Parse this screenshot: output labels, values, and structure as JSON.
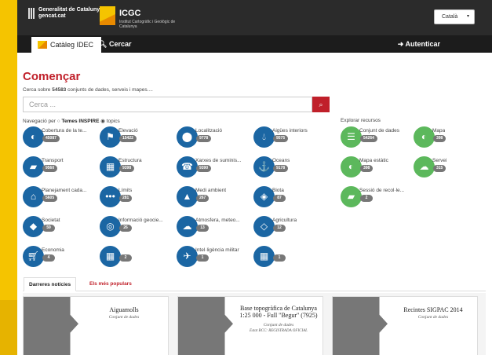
{
  "header": {
    "gencat_line1": "Generalitat de Catalunya",
    "gencat_line2": "gencat.cat",
    "icgc_name": "ICGC",
    "icgc_sub": "Institut Cartogràfic i Geològic de Catalunya",
    "language": "Català"
  },
  "nav": {
    "catalog_tab": "Catàleg IDEC",
    "search_link": "Cercar",
    "login": "Autenticar"
  },
  "main": {
    "title": "Començar",
    "subtitle_pre": "Cerca sobre ",
    "subtitle_count": "54583",
    "subtitle_post": " conjunts de dades, serveis i mapes....",
    "search_placeholder": "Cerca ...",
    "navby_pre": "Navegació per ",
    "navby_inspire": "Temes INSPIRE",
    "navby_topics": "topics",
    "explore_title": "Explorar recursos"
  },
  "topics": [
    {
      "label": "Cobertura de la te...",
      "count": "45087",
      "icon": "globe-icon"
    },
    {
      "label": "Elevació",
      "count": "15422",
      "icon": "flag-icon"
    },
    {
      "label": "Localització",
      "count": "9778",
      "icon": "map-pin-icon"
    },
    {
      "label": "Aigües interiors",
      "count": "9575",
      "icon": "water-drop-icon"
    },
    {
      "label": "Transport",
      "count": "9560",
      "icon": "truck-icon"
    },
    {
      "label": "Estructura",
      "count": "9398",
      "icon": "building-icon"
    },
    {
      "label": "Xarxes de suminis...",
      "count": "9390",
      "icon": "phone-icon"
    },
    {
      "label": "Oceans",
      "count": "9178",
      "icon": "anchor-icon"
    },
    {
      "label": "Planejament cada...",
      "count": "5605",
      "icon": "home-icon"
    },
    {
      "label": "Límits",
      "count": "281",
      "icon": "ellipsis-icon"
    },
    {
      "label": "Medi ambient",
      "count": "267",
      "icon": "tree-icon"
    },
    {
      "label": "Biota",
      "count": "87",
      "icon": "leaf-icon"
    },
    {
      "label": "Societat",
      "count": "59",
      "icon": "speech-bubble-icon"
    },
    {
      "label": "Informació geocie...",
      "count": "26",
      "icon": "target-icon"
    },
    {
      "label": "Atmosfera, meteo...",
      "count": "13",
      "icon": "cloud-icon"
    },
    {
      "label": "Agricultura",
      "count": "12",
      "icon": "leaf-outline-icon"
    },
    {
      "label": "Economia",
      "count": "4",
      "icon": "cart-icon"
    },
    {
      "label": "",
      "count": "2",
      "icon": "grid-icon"
    },
    {
      "label": "Intel·ligència militar",
      "count": "1",
      "icon": "plane-icon"
    },
    {
      "label": "",
      "count": "1",
      "icon": "grid-icon"
    }
  ],
  "resources": [
    {
      "label": "Conjunt de dades",
      "count": "54264",
      "icon": "database-icon"
    },
    {
      "label": "Mapa",
      "count": "398",
      "icon": "map-globe-icon"
    },
    {
      "label": "Mapa estàtic",
      "count": "398",
      "icon": "map-globe-icon"
    },
    {
      "label": "Servei",
      "count": "315",
      "icon": "cloud-icon"
    },
    {
      "label": "Sessió de recol·le...",
      "count": "2",
      "icon": "truck-icon"
    }
  ],
  "tabs": {
    "latest": "Darreres notícies",
    "popular": "Els més populars"
  },
  "news": [
    {
      "title": "Aiguamolls",
      "type": "Conjunt de dades",
      "state": ""
    },
    {
      "title": "Base topogràfica de Catalunya 1:25 000 - Full \"Begur\" (7925)",
      "type": "Conjunt de dades",
      "state": "Estat BCC: REGISTRADA OFICIAL"
    },
    {
      "title": "Recintes SIGPAC 2014",
      "type": "Conjunt de dades",
      "state": ""
    }
  ]
}
